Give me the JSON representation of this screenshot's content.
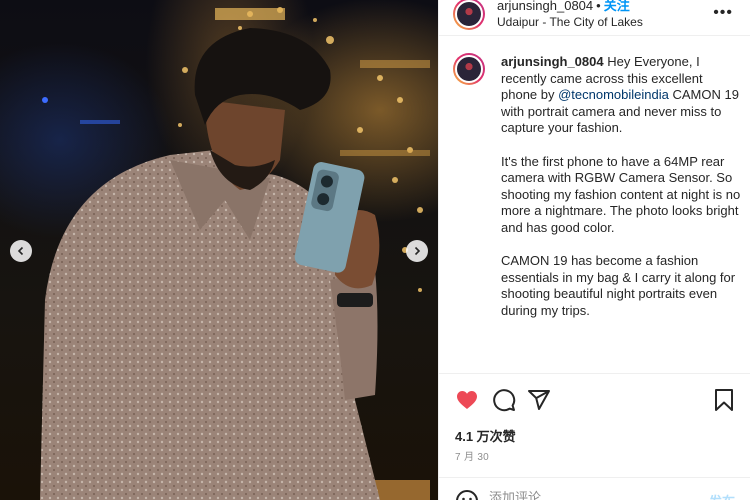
{
  "post": {
    "username": "arjunsingh_0804",
    "dot": "•",
    "follow_label": "关注",
    "location": "Udaipur - The City of Lakes",
    "more_label": "•••"
  },
  "caption": {
    "username": "arjunsingh_0804",
    "intro_a": " Hey Everyone, I recently came across this excellent phone by ",
    "mention": "@tecnomobileindia",
    "intro_b": " CAMON 19 with portrait camera and never miss to capture your fashion.",
    "paragraph2": "It's the first phone to have a 64MP rear camera with RGBW Camera Sensor. So shooting my fashion content at night is no more a nightmare. The photo looks bright and has good color.",
    "paragraph3": "CAMON 19 has become a fashion essentials in my bag & I carry it along for shooting beautiful night portraits even during my trips."
  },
  "actions": {
    "like_icon": "heart-filled-icon",
    "comment_icon": "comment-icon",
    "share_icon": "paper-plane-icon",
    "save_icon": "bookmark-icon",
    "liked_color": "#ed4956"
  },
  "likes_label": "4.1 万次赞",
  "date_label": "7 月 30",
  "comment_box": {
    "placeholder": "添加评论……",
    "post_label": "发布"
  }
}
